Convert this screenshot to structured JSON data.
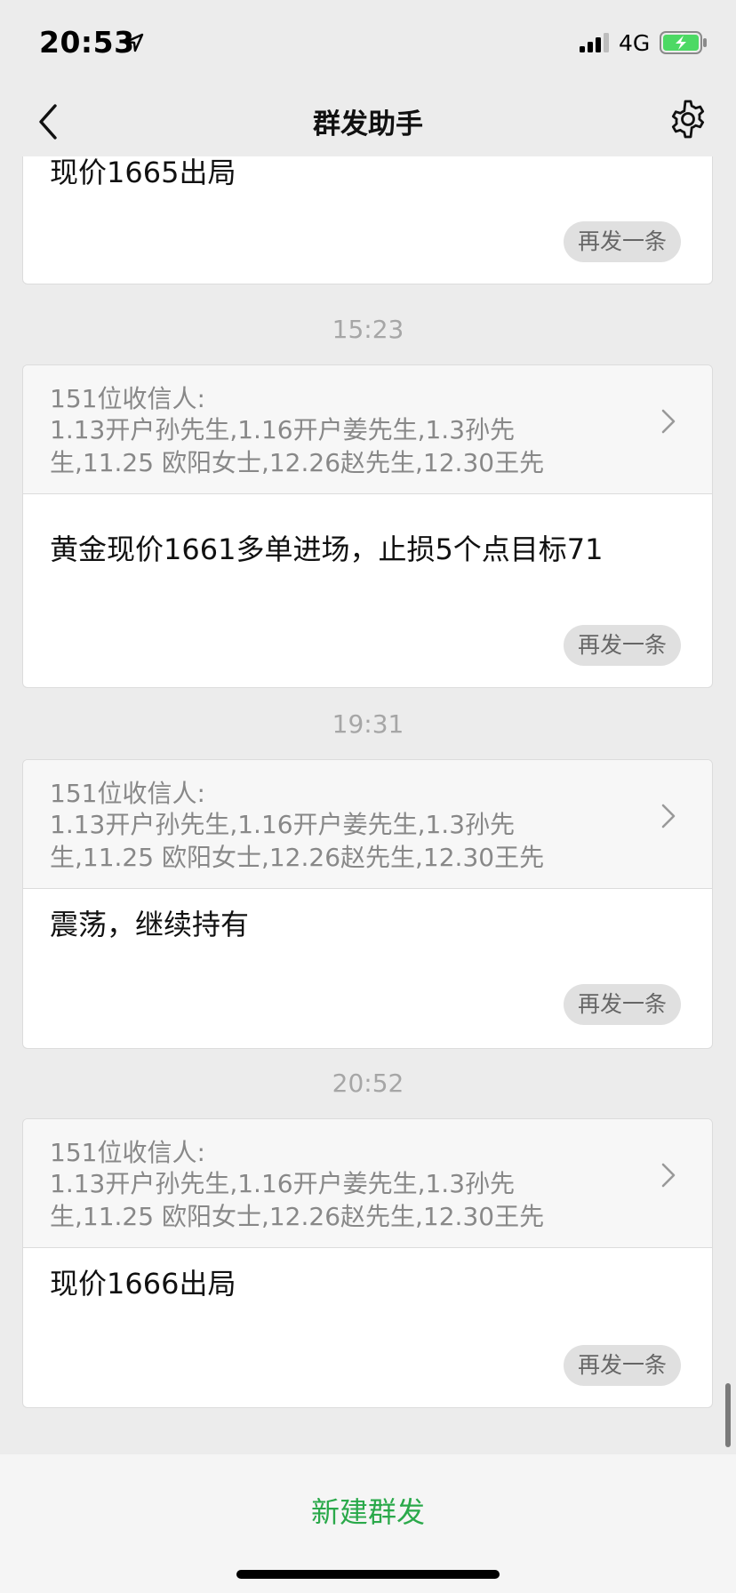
{
  "status": {
    "time": "20:53",
    "network": "4G"
  },
  "nav": {
    "title": "群发助手"
  },
  "feed": {
    "top_partial_message": "现价1665出局",
    "top_resend_label": "再发一条",
    "groups": [
      {
        "timestamp": "15:23",
        "recipients_count": "151位收信人:",
        "recipients_line1": "1.13开户孙先生,1.16开户姜先生,1.3孙先",
        "recipients_line2": "生,11.25 欧阳女士,12.26赵先生,12.30王先",
        "message": "黄金现价1661多单进场，止损5个点目标71",
        "resend_label": "再发一条"
      },
      {
        "timestamp": "19:31",
        "recipients_count": "151位收信人:",
        "recipients_line1": "1.13开户孙先生,1.16开户姜先生,1.3孙先",
        "recipients_line2": "生,11.25 欧阳女士,12.26赵先生,12.30王先",
        "message": "震荡，继续持有",
        "resend_label": "再发一条"
      },
      {
        "timestamp": "20:52",
        "recipients_count": "151位收信人:",
        "recipients_line1": "1.13开户孙先生,1.16开户姜先生,1.3孙先",
        "recipients_line2": "生,11.25 欧阳女士,12.26赵先生,12.30王先",
        "message": "现价1666出局",
        "resend_label": "再发一条"
      }
    ]
  },
  "bottom": {
    "new_broadcast_label": "新建群发"
  },
  "colors": {
    "accent_green": "#2aa94a",
    "background": "#ececec",
    "battery_green": "#4cd964"
  },
  "icons": [
    "location-arrow-icon",
    "signal-icon",
    "battery-charging-icon",
    "back-chevron-icon",
    "gear-icon",
    "chevron-right-icon"
  ]
}
